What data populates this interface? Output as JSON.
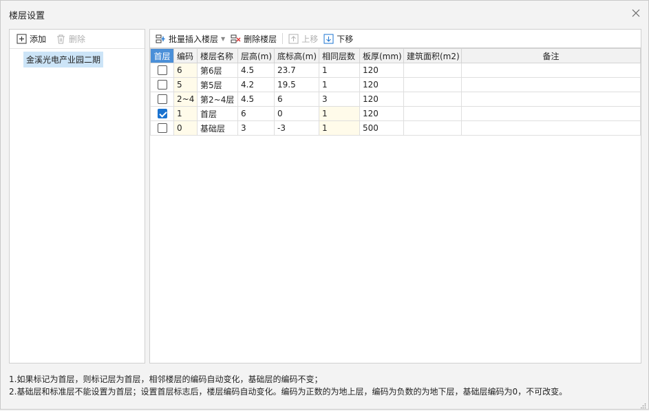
{
  "window": {
    "title": "楼层设置"
  },
  "left_toolbar": {
    "add_label": "添加",
    "delete_label": "删除"
  },
  "tree": {
    "items": [
      {
        "label": "金溪光电产业园二期"
      }
    ]
  },
  "toolbar": {
    "batch_insert_label": "批量插入楼层",
    "delete_floor_label": "删除楼层",
    "move_up_label": "上移",
    "move_down_label": "下移"
  },
  "table": {
    "headers": {
      "first_floor": "首层",
      "code": "编码",
      "name": "楼层名称",
      "height": "层高(m)",
      "base_elev": "底标高(m)",
      "same_count": "相同层数",
      "slab": "板厚(mm)",
      "area": "建筑面积(m2)",
      "remark": "备注"
    },
    "rows": [
      {
        "first": false,
        "code": "6",
        "name": "第6层",
        "height": "4.5",
        "base": "23.7",
        "same": "1",
        "slab": "120",
        "area": "",
        "remark": ""
      },
      {
        "first": false,
        "code": "5",
        "name": "第5层",
        "height": "4.2",
        "base": "19.5",
        "same": "1",
        "slab": "120",
        "area": "",
        "remark": ""
      },
      {
        "first": false,
        "code": "2~4",
        "name": "第2~4层",
        "height": "4.5",
        "base": "6",
        "same": "3",
        "slab": "120",
        "area": "",
        "remark": ""
      },
      {
        "first": true,
        "code": "1",
        "name": "首层",
        "height": "6",
        "base": "0",
        "same": "1",
        "slab": "120",
        "area": "",
        "remark": ""
      },
      {
        "first": false,
        "code": "0",
        "name": "基础层",
        "height": "3",
        "base": "-3",
        "same": "1",
        "slab": "500",
        "area": "",
        "remark": ""
      }
    ]
  },
  "notes": {
    "line1": "1.如果标记为首层，则标记层为首层，相邻楼层的编码自动变化，基础层的编码不变；",
    "line2": "2.基础层和标准层不能设置为首层；设置首层标志后，楼层编码自动变化。编码为正数的为地上层，编码为负数的为地下层，基础层编码为0，不可改变。"
  },
  "colors": {
    "header_accent": "#4a8fd8",
    "selection": "#cce4f7",
    "checked": "#1a73d0",
    "readonly_cell": "#fffbea"
  }
}
